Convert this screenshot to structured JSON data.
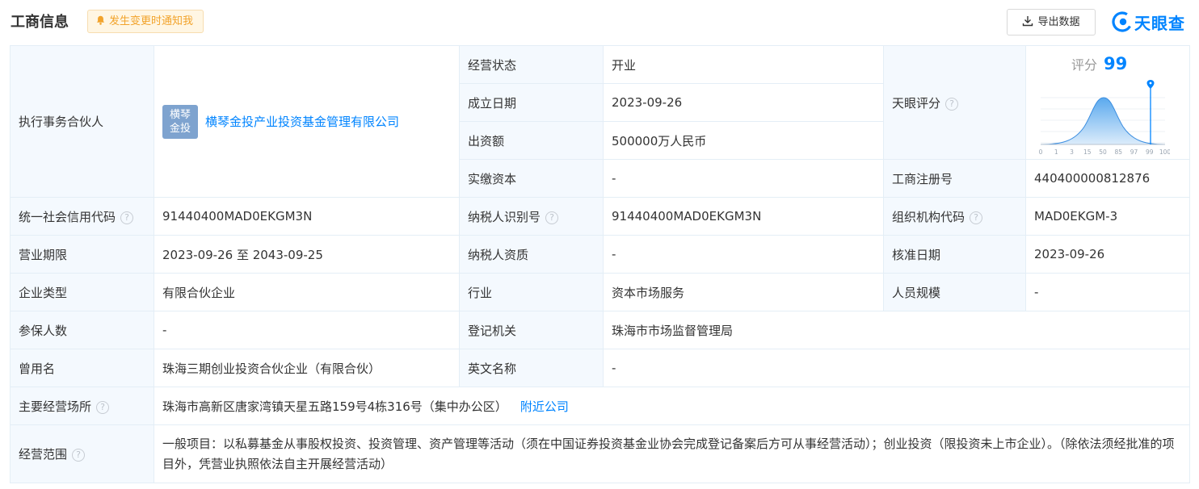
{
  "header": {
    "title": "工商信息",
    "notify_label": "发生变更时通知我",
    "export_label": "导出数据",
    "logo_text": "天眼查"
  },
  "rows": {
    "partner_label": "执行事务合伙人",
    "partner_logo_text": "横琴\n金投",
    "partner_name": "横琴金投产业投资基金管理有限公司",
    "status_label": "经营状态",
    "status_value": "开业",
    "score_label": "天眼评分",
    "score_prefix": "评分",
    "score_value": "99",
    "score_ticks": [
      "0",
      "1",
      "3",
      "15",
      "50",
      "85",
      "97",
      "99",
      "100"
    ],
    "established_label": "成立日期",
    "established_value": "2023-09-26",
    "capital_label": "出资额",
    "capital_value": "500000万人民币",
    "paid_label": "实缴资本",
    "paid_value": "-",
    "regno_label": "工商注册号",
    "regno_value": "440400000812876",
    "credit_label": "统一社会信用代码",
    "credit_value": "91440400MAD0EKGM3N",
    "taxid_label": "纳税人识别号",
    "taxid_value": "91440400MAD0EKGM3N",
    "orgcode_label": "组织机构代码",
    "orgcode_value": "MAD0EKGM-3",
    "term_label": "营业期限",
    "term_value": "2023-09-26 至 2043-09-25",
    "taxqual_label": "纳税人资质",
    "taxqual_value": "-",
    "approve_label": "核准日期",
    "approve_value": "2023-09-26",
    "type_label": "企业类型",
    "type_value": "有限合伙企业",
    "industry_label": "行业",
    "industry_value": "资本市场服务",
    "staff_label": "人员规模",
    "staff_value": "-",
    "insured_label": "参保人数",
    "insured_value": "-",
    "authority_label": "登记机关",
    "authority_value": "珠海市市场监督管理局",
    "former_label": "曾用名",
    "former_value": "珠海三期创业投资合伙企业（有限合伙）",
    "english_label": "英文名称",
    "english_value": "-",
    "address_label": "主要经营场所",
    "address_value": "珠海市高新区唐家湾镇天星五路159号4栋316号（集中办公区）",
    "nearby_label": "附近公司",
    "scope_label": "经营范围",
    "scope_value": "一般项目：以私募基金从事股权投资、投资管理、资产管理等活动（须在中国证券投资基金业协会完成登记备案后方可从事经营活动）；创业投资（限投资未上市企业）。（除依法须经批准的项目外，凭营业执照依法自主开展经营活动）"
  },
  "help_icon": "question-circle-icon",
  "colors": {
    "accent": "#0084ff",
    "label_bg": "#f4f9fe",
    "border": "#e4eef6",
    "notify": "#f2a32b"
  }
}
